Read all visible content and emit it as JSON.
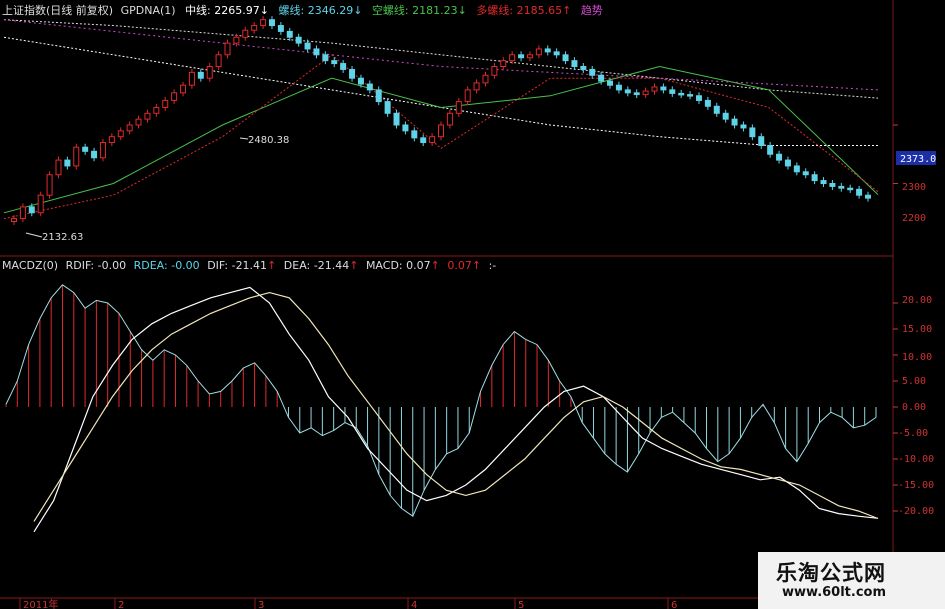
{
  "header": {
    "title": "上证指数(日线 前复权)",
    "indicator": "GPDNA(1)",
    "mid_line_label": "中线:",
    "mid_line_value": "2265.97",
    "mid_line_arrow": "↓",
    "spiral_label": "螺线:",
    "spiral_value": "2346.29",
    "spiral_arrow": "↓",
    "short_spiral_label": "空螺线:",
    "short_spiral_value": "2181.23",
    "short_spiral_arrow": "↓",
    "long_spiral_label": "多螺线:",
    "long_spiral_value": "2185.65",
    "long_spiral_arrow": "↑",
    "trend_label": "趋势",
    "colors": {
      "mid": "#ffffff",
      "spiral": "#5fd3e8",
      "short": "#49c24a",
      "long": "#e02a2a",
      "trend": "#d04ad0"
    }
  },
  "macd_header": {
    "name": "MACDZ(0)",
    "rdif_label": "RDIF:",
    "rdif_value": "-0.00",
    "rdea_label": "RDEA:",
    "rdea_value": "-0.00",
    "dif_label": "DIF:",
    "dif_value": "-21.41",
    "dif_arrow": "↑",
    "dea_label": "DEA:",
    "dea_value": "-21.44",
    "dea_arrow": "↑",
    "macd_label": "MACD:",
    "macd_value": "0.07",
    "macd_arrow": "↑",
    "extra_value": "0.07",
    "extra_arrow": "↑",
    "tail": ":-"
  },
  "price_axis": {
    "current_price": "2373.0",
    "ticks": [
      "2300",
      "2200"
    ]
  },
  "annotations": {
    "high_label": "2480.38",
    "low_label": "2132.63"
  },
  "macd_axis": {
    "ticks": [
      "20.00",
      "15.00",
      "10.00",
      "5.00",
      "0.00",
      "-5.00",
      "-10.00",
      "-15.00",
      "-20.00"
    ]
  },
  "time_axis": {
    "labels": [
      "2011年",
      "2",
      "3",
      "4",
      "5",
      "6"
    ]
  },
  "watermark": {
    "line1": "乐淘公式网",
    "line2": "www.60lt.com"
  },
  "chart_data": [
    {
      "type": "line",
      "title": "上证指数(日线 前复权)",
      "y_ticks": [
        2300,
        2200
      ],
      "ylim": [
        2100,
        2500
      ],
      "x_labels": [
        "2011年",
        "2",
        "3",
        "4",
        "5",
        "6"
      ],
      "close": [
        2140,
        2160,
        2150,
        2180,
        2215,
        2240,
        2230,
        2262,
        2255,
        2244,
        2270,
        2280,
        2290,
        2300,
        2310,
        2320,
        2330,
        2342,
        2355,
        2368,
        2390,
        2380,
        2400,
        2420,
        2440,
        2450,
        2462,
        2470,
        2480,
        2470,
        2460,
        2450,
        2440,
        2430,
        2420,
        2410,
        2405,
        2395,
        2380,
        2370,
        2360,
        2340,
        2320,
        2300,
        2290,
        2278,
        2270,
        2280,
        2300,
        2320,
        2340,
        2360,
        2372,
        2385,
        2400,
        2410,
        2420,
        2415,
        2420,
        2430,
        2425,
        2420,
        2410,
        2400,
        2395,
        2385,
        2375,
        2368,
        2360,
        2355,
        2352,
        2358,
        2365,
        2360,
        2354,
        2352,
        2350,
        2342,
        2332,
        2320,
        2310,
        2300,
        2295,
        2280,
        2265,
        2250,
        2240,
        2230,
        2220,
        2215,
        2205,
        2200,
        2195,
        2192,
        2190,
        2180,
        2175
      ],
      "series": [
        {
          "name": "中线",
          "values": [
            2450,
            2420,
            2390,
            2360,
            2330,
            2300,
            2280,
            2265,
            2265
          ]
        },
        {
          "name": "螺线",
          "values": [
            2480,
            2470,
            2455,
            2440,
            2420,
            2400,
            2380,
            2360,
            2346
          ]
        },
        {
          "name": "空螺线",
          "values": [
            2150,
            2200,
            2300,
            2380,
            2330,
            2350,
            2400,
            2360,
            2181
          ]
        },
        {
          "name": "多螺线",
          "values": [
            2140,
            2180,
            2280,
            2420,
            2260,
            2380,
            2380,
            2330,
            2186
          ]
        },
        {
          "name": "趋势",
          "values": [
            2480,
            2460,
            2440,
            2420,
            2400,
            2390,
            2380,
            2370,
            2360
          ]
        }
      ]
    },
    {
      "type": "bar",
      "title": "MACDZ(0)",
      "ylim": [
        -22,
        25
      ],
      "y_ticks": [
        20,
        15,
        10,
        5,
        0,
        -5,
        -10,
        -15,
        -20
      ],
      "series": [
        {
          "name": "MACD",
          "values": [
            0.5,
            5,
            12,
            17,
            21,
            23.5,
            22,
            19,
            20.5,
            20,
            18,
            14.5,
            11,
            9,
            11,
            10,
            8,
            5,
            2.5,
            3,
            5,
            7.5,
            8.5,
            6,
            3,
            -2,
            -5,
            -4,
            -5.5,
            -4.5,
            -3,
            -4,
            -7.5,
            -13,
            -17,
            -19.5,
            -21,
            -16,
            -12,
            -9,
            -8,
            -5,
            3,
            8,
            12,
            14.5,
            13,
            12,
            9,
            5,
            2,
            -3,
            -6,
            -9,
            -11,
            -12.5,
            -9,
            -5,
            -2,
            -1,
            -3,
            -5,
            -8,
            -10.5,
            -9,
            -6,
            -2,
            0.5,
            -3,
            -8,
            -10.5,
            -7,
            -3,
            -1,
            -2,
            -4,
            -3.5,
            -2
          ]
        },
        {
          "name": "DIF",
          "values": [
            -24,
            -18,
            -8,
            2,
            8,
            13,
            16,
            18,
            19.5,
            21,
            22,
            23,
            20,
            14,
            9,
            2,
            -2,
            -8,
            -12,
            -16,
            -18,
            -17,
            -15,
            -12,
            -8,
            -4,
            0,
            3,
            4,
            2,
            -2,
            -6,
            -8,
            -9.5,
            -11,
            -12,
            -13,
            -14,
            -13.5,
            -16,
            -19.5,
            -20.5,
            -21,
            -21.4
          ]
        },
        {
          "name": "DEA",
          "values": [
            -22,
            -16,
            -10,
            -4,
            2,
            7,
            11,
            14,
            16,
            18,
            19.5,
            21,
            22,
            21,
            17,
            12,
            6,
            1,
            -4,
            -9,
            -13,
            -16,
            -17,
            -16,
            -13,
            -10,
            -6,
            -2,
            1,
            2,
            0,
            -3,
            -6,
            -8,
            -10,
            -11.5,
            -12,
            -13,
            -14,
            -15,
            -17,
            -19,
            -20,
            -21.44
          ]
        }
      ]
    }
  ]
}
